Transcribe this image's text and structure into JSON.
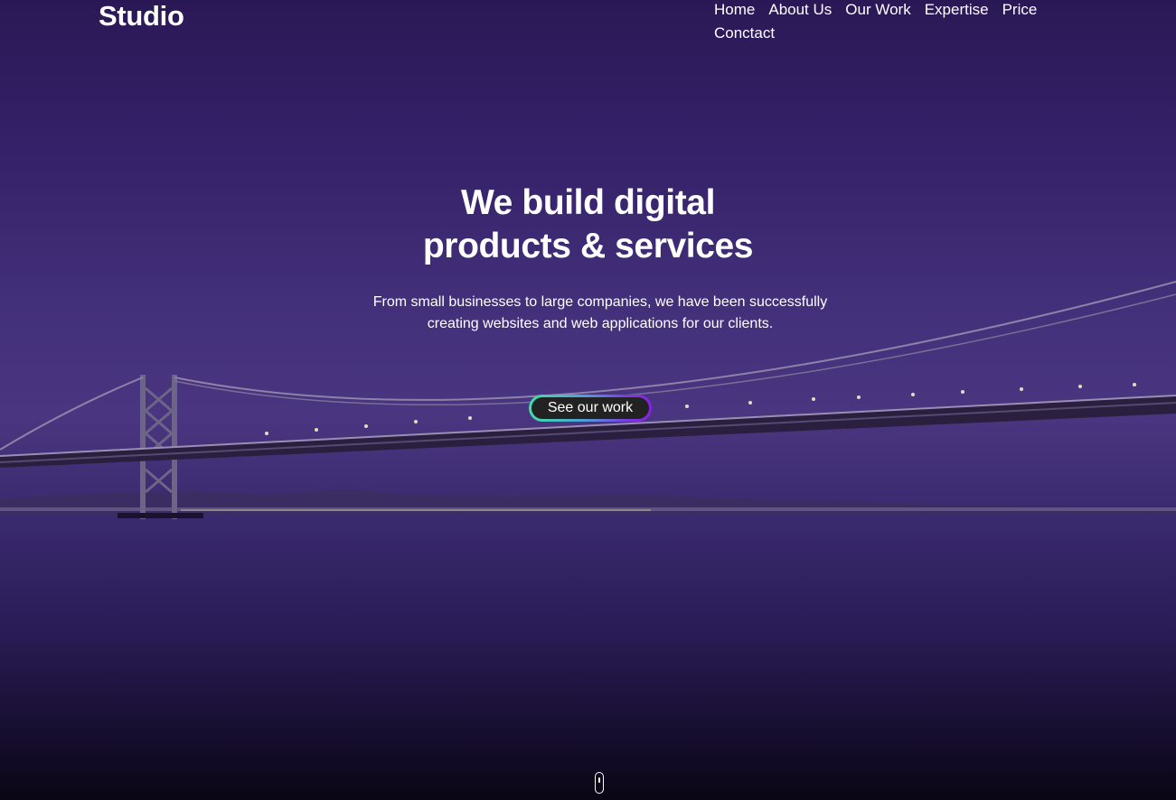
{
  "brand": {
    "name": "Studio"
  },
  "nav": {
    "items": [
      {
        "label": "Home"
      },
      {
        "label": "About Us"
      },
      {
        "label": "Our Work"
      },
      {
        "label": "Expertise"
      },
      {
        "label": "Price"
      },
      {
        "label": "Conctact"
      }
    ]
  },
  "hero": {
    "headline_line1": "We build digital",
    "headline_line2": "products & services",
    "subtitle": "From small businesses to large companies, we have been successfully creating websites and web applications for our clients.",
    "cta_label": "See our work",
    "background_image": "bridge-at-night",
    "scroll_icon": "mouse-scroll-icon"
  },
  "colors": {
    "overlay": "#35226a",
    "cta_fill": "#222222",
    "cta_gradient_start": "#3ee0a6",
    "cta_gradient_end": "#8a1fe6",
    "text": "#ffffff"
  }
}
